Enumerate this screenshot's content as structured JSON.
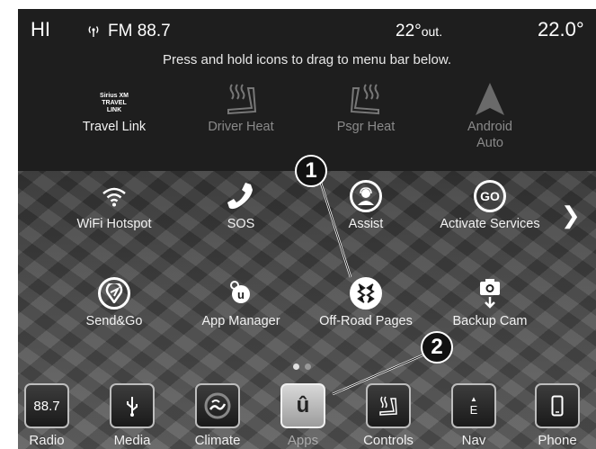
{
  "status": {
    "hi_label": "HI",
    "radio_label": "FM 88.7",
    "outside_temp": "22°",
    "outside_suffix": "out.",
    "set_temp": "22.0°"
  },
  "instruction": "Press and hold icons to drag to menu bar below.",
  "apps_row1": [
    {
      "label": "Travel Link",
      "icon": "siriusxm-travel-link-logo",
      "logo_lines": [
        "Sirius XM",
        "TRAVEL",
        "LINK"
      ],
      "enabled": true
    },
    {
      "label": "Driver Heat",
      "icon": "heated-seat-icon",
      "enabled": false
    },
    {
      "label": "Psgr Heat",
      "icon": "heated-seat-icon",
      "enabled": false
    },
    {
      "label": "Android Auto",
      "icon": "android-auto-icon",
      "enabled": false
    }
  ],
  "apps_row2": [
    {
      "label": "WiFi Hotspot",
      "icon": "wifi-icon"
    },
    {
      "label": "SOS",
      "icon": "phone-handset-icon"
    },
    {
      "label": "Assist",
      "icon": "assist-person-icon"
    },
    {
      "label": "Activate Services",
      "icon": "go-icon",
      "icon_text": "GO"
    }
  ],
  "apps_row3": [
    {
      "label": "Send&Go",
      "icon": "send-and-go-icon"
    },
    {
      "label": "App Manager",
      "icon": "app-manager-icon"
    },
    {
      "label": "Off-Road Pages",
      "icon": "tire-tread-icon"
    },
    {
      "label": "Backup Cam",
      "icon": "backup-camera-icon"
    }
  ],
  "callouts": [
    "1",
    "2"
  ],
  "pager": {
    "pages": 2,
    "current": 1
  },
  "menubar": [
    {
      "label": "Radio",
      "icon_text": "88.7",
      "icon": "radio-icon",
      "active": false
    },
    {
      "label": "Media",
      "icon": "usb-icon",
      "active": false
    },
    {
      "label": "Climate",
      "icon": "climate-icon",
      "active": false
    },
    {
      "label": "Apps",
      "icon": "apps-u-icon",
      "icon_text": "û",
      "active": true
    },
    {
      "label": "Controls",
      "icon": "controls-icon",
      "active": false
    },
    {
      "label": "Nav",
      "icon": "compass-icon",
      "icon_text": "E",
      "active": false
    },
    {
      "label": "Phone",
      "icon": "phone-icon",
      "active": false
    }
  ]
}
